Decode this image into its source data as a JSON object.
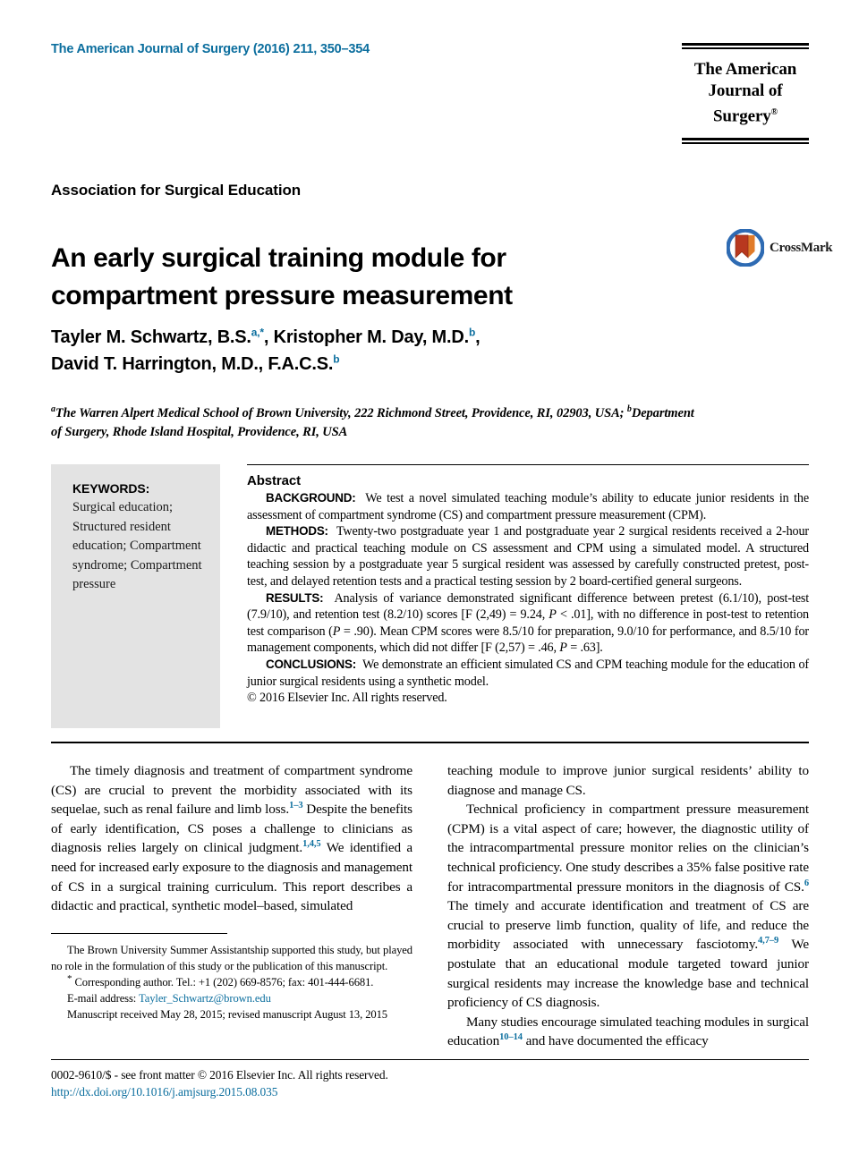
{
  "header": {
    "journal_reference": "The American Journal of Surgery (2016) 211, 350–354",
    "logo_line1": "The American",
    "logo_line2": "Journal of Surgery",
    "logo_registered": "®"
  },
  "crossmark": {
    "label": "CrossMark",
    "ring_color": "#2e6bb3",
    "mark_color": "#c0392b"
  },
  "article": {
    "section_label": "Association for Surgical Education",
    "title_line1": "An early surgical training module for",
    "title_line2": "compartment pressure measurement"
  },
  "authors": {
    "line1_a": "Tayler M. Schwartz, B.S.",
    "line1_sup1": "a,*",
    "line1_b": ", Kristopher M. Day, M.D.",
    "line1_sup2": "b",
    "line1_c": ",",
    "line2_a": "David T. Harrington, M.D., F.A.C.S.",
    "line2_sup1": "b"
  },
  "affiliations": {
    "sup_a": "a",
    "text_a": "The Warren Alpert Medical School of Brown University, 222 Richmond Street, Providence, RI, 02903, USA; ",
    "sup_b": "b",
    "text_b": "Department of Surgery, Rhode Island Hospital, Providence, RI, USA"
  },
  "keywords": {
    "title": "KEYWORDS:",
    "items": "Surgical education; Structured resident education; Compartment syndrome; Compartment pressure"
  },
  "abstract": {
    "heading": "Abstract",
    "background_label": "BACKGROUND:",
    "background_text": "We test a novel simulated teaching module’s ability to educate junior residents in the assessment of compartment syndrome (CS) and compartment pressure measurement (CPM).",
    "methods_label": "METHODS:",
    "methods_text": "Twenty-two postgraduate year 1 and postgraduate year 2 surgical residents received a 2-hour didactic and practical teaching module on CS assessment and CPM using a simulated model. A structured teaching session by a postgraduate year 5 surgical resident was assessed by carefully constructed pretest, post-test, and delayed retention tests and a practical testing session by 2 board-certified general surgeons.",
    "results_label": "RESULTS:",
    "results_text_1": "Analysis of variance demonstrated significant difference between pretest (6.1/10), post-test (7.9/10), and retention test (8.2/10) scores [F (2,49) = 9.24, ",
    "results_italic_1": "P",
    "results_text_2": " < .01], with no difference in post-test to retention test comparison (",
    "results_italic_2": "P",
    "results_text_3": " = .90). Mean CPM scores were 8.5/10 for preparation, 9.0/10 for performance, and 8.5/10 for management components, which did not differ [F (2,57) = .46, ",
    "results_italic_3": "P",
    "results_text_4": " = .63].",
    "conclusions_label": "CONCLUSIONS:",
    "conclusions_text": "We demonstrate an efficient simulated CS and CPM teaching module for the education of junior surgical residents using a synthetic model.",
    "copyright": "© 2016 Elsevier Inc. All rights reserved."
  },
  "body": {
    "left_p1_a": "The timely diagnosis and treatment of compartment syndrome (CS) are crucial to prevent the morbidity associated with its sequelae, such as renal failure and limb loss.",
    "left_p1_ref1": "1–3",
    "left_p1_b": " Despite the benefits of early identification, CS poses a challenge to clinicians as diagnosis relies largely on clinical judgment.",
    "left_p1_ref2": "1,4,5",
    "left_p1_c": " We identified a need for increased early exposure to the diagnosis and management of CS in a surgical training curriculum. This report describes a didactic and practical, synthetic model–based, simulated",
    "right_p1": "teaching module to improve junior surgical residents’ ability to diagnose and manage CS.",
    "right_p2_a": "Technical proficiency in compartment pressure measurement (CPM) is a vital aspect of care; however, the diagnostic utility of the intracompartmental pressure monitor relies on the clinician’s technical proficiency. One study describes a 35% false positive rate for intracompartmental pressure monitors in the diagnosis of CS.",
    "right_p2_ref1": "6",
    "right_p2_b": " The timely and accurate identification and treatment of CS are crucial to preserve limb function, quality of life, and reduce the morbidity associated with unnecessary fasciotomy.",
    "right_p2_ref2": "4,7–9",
    "right_p2_c": " We postulate that an educational module targeted toward junior surgical residents may increase the knowledge base and technical proficiency of CS diagnosis.",
    "right_p3_a": "Many studies encourage simulated teaching modules in surgical education",
    "right_p3_ref1": "10–14",
    "right_p3_b": " and have documented the efficacy"
  },
  "footnotes": {
    "funding": "The Brown University Summer Assistantship supported this study, but played no role in the formulation of this study or the publication of this manuscript.",
    "corresponding_star": "*",
    "corresponding": " Corresponding author. Tel.: +1 (202) 669-8576; fax: 401-444-6681.",
    "email_label": "E-mail address: ",
    "email": "Tayler_Schwartz@brown.edu",
    "received": "Manuscript received May 28, 2015; revised manuscript August 13, 2015"
  },
  "footer": {
    "issn_line": "0002-9610/$ - see front matter © 2016 Elsevier Inc. All rights reserved.",
    "doi": "http://dx.doi.org/10.1016/j.amjsurg.2015.08.035"
  }
}
